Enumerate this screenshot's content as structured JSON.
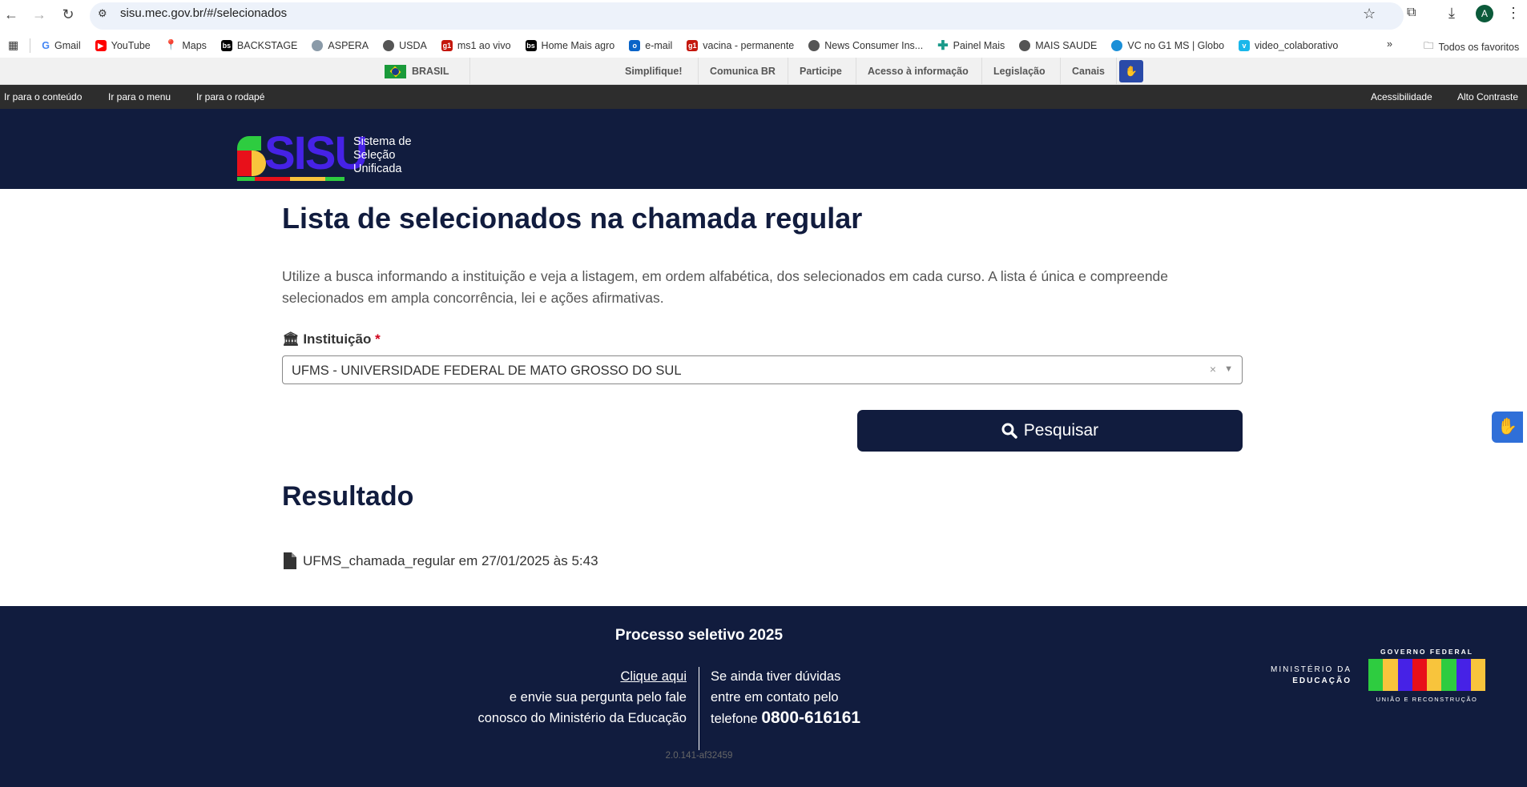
{
  "browser": {
    "url": "sisu.mec.gov.br/#/selecionados",
    "profile_initial": "A",
    "bookmarks": [
      "Gmail",
      "YouTube",
      "Maps",
      "BACKSTAGE",
      "ASPERA",
      "USDA",
      "ms1 ao vivo",
      "Home Mais agro",
      "e-mail",
      "vacina - permanente",
      "News Consumer Ins...",
      "Painel Mais",
      "MAIS SAUDE",
      "VC no G1 MS | Globo",
      "video_colaborativo"
    ],
    "all_bookmarks": "Todos os favoritos",
    "more": "»"
  },
  "govbar": {
    "country": "BRASIL",
    "links": [
      "Simplifique!",
      "Comunica BR",
      "Participe",
      "Acesso à informação",
      "Legislação",
      "Canais"
    ]
  },
  "skip": {
    "links": [
      "Ir para o conteúdo",
      "Ir para o menu",
      "Ir para o rodapé"
    ],
    "right": [
      "Acessibilidade",
      "Alto Contraste"
    ]
  },
  "header": {
    "logo_text": "SISU",
    "tagline": [
      "Sistema de",
      "Seleção",
      "Unificada"
    ]
  },
  "main": {
    "title": "Lista de selecionados na chamada regular",
    "intro": "Utilize a busca informando a instituição e veja a listagem, em ordem alfabética, dos selecionados em cada curso. A lista é única e compreende selecionados em ampla concorrência, lei e ações afirmativas.",
    "institution_label": "Instituição",
    "required_mark": "*",
    "institution_value": "UFMS - UNIVERSIDADE FEDERAL DE MATO GROSSO DO SUL",
    "clear": "×",
    "search_button": "Pesquisar",
    "result_title": "Resultado",
    "result_file": "UFMS_chamada_regular em 27/01/2025 às 5:43"
  },
  "footer": {
    "title": "Processo seletivo 2025",
    "click_here": "Clique aqui",
    "left_lines": [
      "e envie sua pergunta pelo fale",
      "conosco do Ministério da Educação"
    ],
    "right_lines": [
      "Se ainda tiver dúvidas",
      "entre em contato pelo"
    ],
    "phone_prefix": "telefone",
    "phone": "0800-616161",
    "version": "2.0.141-af32459",
    "ministry": [
      "MINISTÉRIO DA",
      "EDUCAÇÃO"
    ],
    "gov_top": "GOVERNO FEDERAL",
    "gov_word": "BRASIL",
    "gov_bottom": "UNIÃO E RECONSTRUÇÃO"
  },
  "colors": {
    "navy": "#111c3e",
    "accent": "#4622e6"
  }
}
